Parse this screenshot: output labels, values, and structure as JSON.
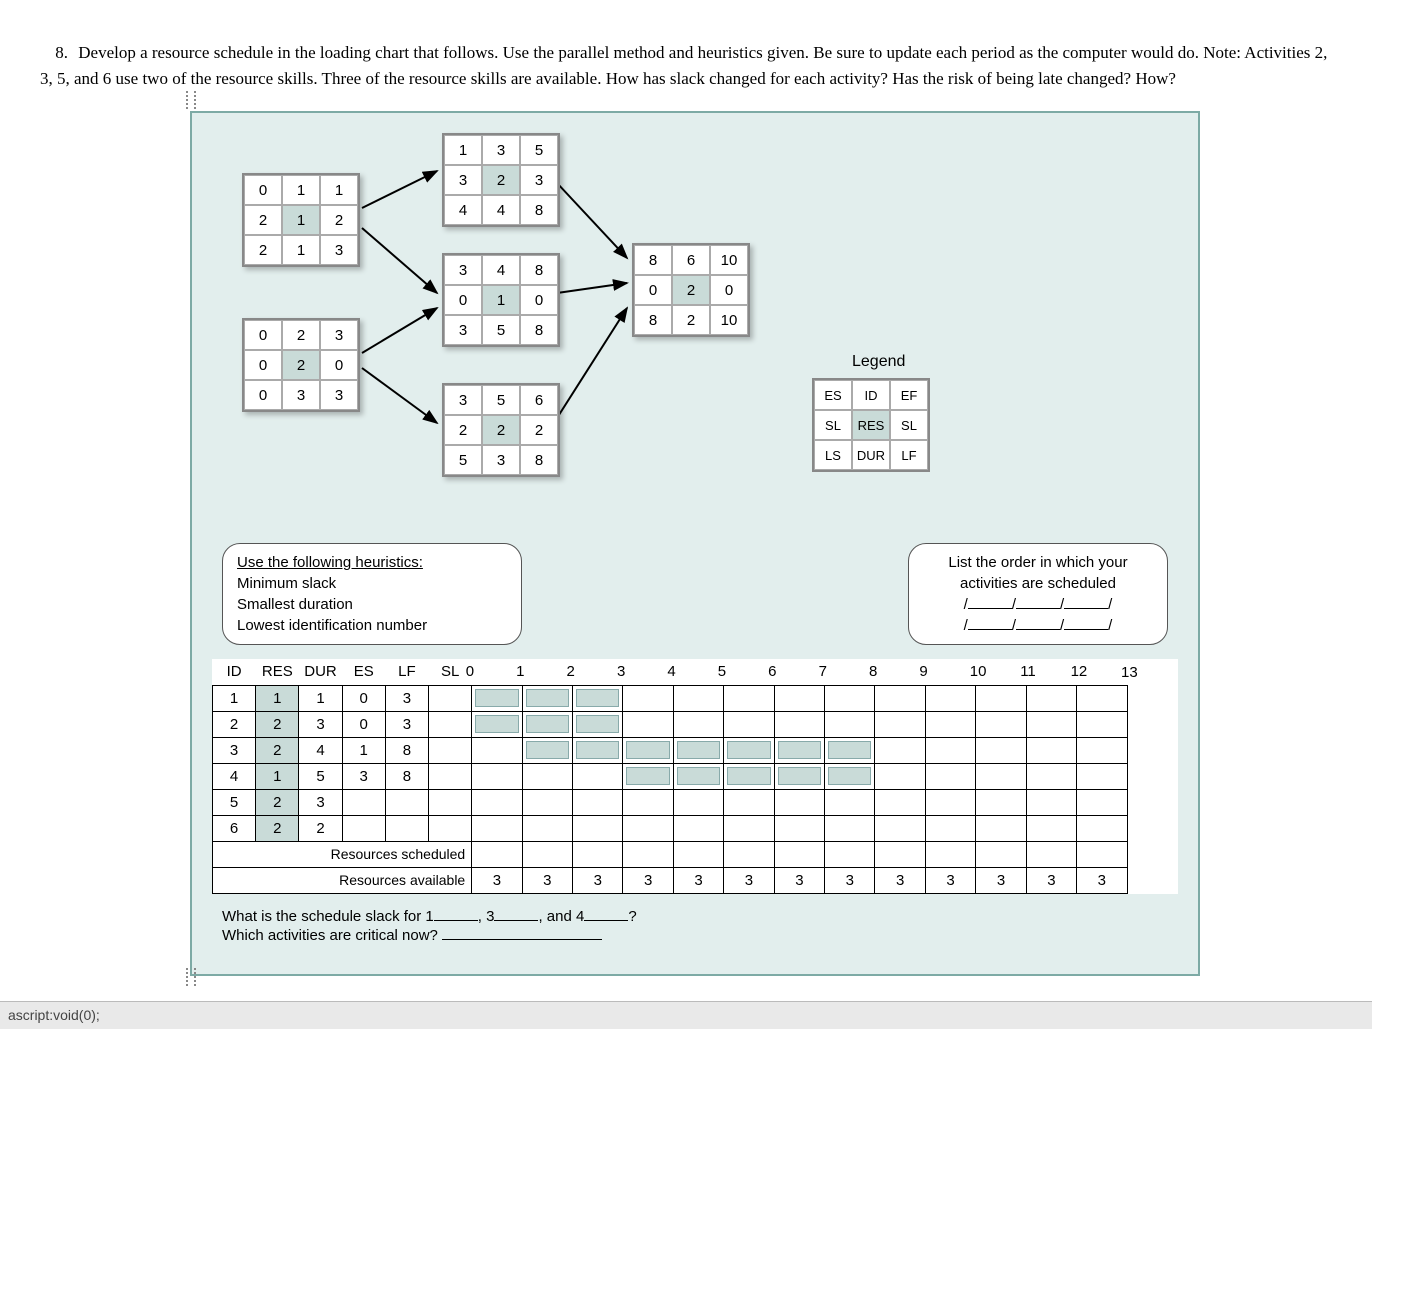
{
  "question": {
    "number": "8.",
    "text": "Develop a resource schedule in the loading chart that follows. Use the parallel method and heuristics given. Be sure to update each period as the computer would do. Note: Activities 2, 3, 5, and 6 use two of the resource skills. Three of the resource skills are available. How has slack changed for each activity? Has the risk of being late changed? How?"
  },
  "activities": {
    "a1": {
      "cells": [
        "0",
        "1",
        "1",
        "2",
        "1",
        "2",
        "2",
        "1",
        "3"
      ]
    },
    "a2": {
      "cells": [
        "0",
        "2",
        "3",
        "0",
        "2",
        "0",
        "0",
        "3",
        "3"
      ]
    },
    "a3": {
      "cells": [
        "1",
        "3",
        "5",
        "3",
        "2",
        "3",
        "4",
        "4",
        "8"
      ]
    },
    "a4": {
      "cells": [
        "3",
        "4",
        "8",
        "0",
        "1",
        "0",
        "3",
        "5",
        "8"
      ]
    },
    "a5": {
      "cells": [
        "3",
        "5",
        "6",
        "2",
        "2",
        "2",
        "5",
        "3",
        "8"
      ]
    },
    "a6": {
      "cells": [
        "8",
        "6",
        "10",
        "0",
        "2",
        "0",
        "8",
        "2",
        "10"
      ]
    }
  },
  "legend": {
    "label": "Legend",
    "cells": [
      "ES",
      "ID",
      "EF",
      "SL",
      "RES",
      "SL",
      "LS",
      "DUR",
      "LF"
    ]
  },
  "heuristics": {
    "title": "Use the following heuristics:",
    "items": [
      "Minimum slack",
      "Smallest duration",
      "Lowest identification number"
    ]
  },
  "orderbox": {
    "line1": "List the order in which your",
    "line2": "activities are scheduled"
  },
  "scheduleHeaders": [
    "ID",
    "RES",
    "DUR",
    "ES",
    "LF",
    "SL",
    "0",
    "1",
    "2",
    "3",
    "4",
    "5",
    "6",
    "7",
    "8",
    "9",
    "10",
    "11",
    "12",
    "13"
  ],
  "rows": [
    {
      "id": "1",
      "res": "1",
      "dur": "1",
      "es": "0",
      "lf": "3",
      "bar": [
        0,
        3
      ]
    },
    {
      "id": "2",
      "res": "2",
      "dur": "3",
      "es": "0",
      "lf": "3",
      "bar": [
        0,
        3
      ]
    },
    {
      "id": "3",
      "res": "2",
      "dur": "4",
      "es": "1",
      "lf": "8",
      "bar": [
        1,
        8
      ]
    },
    {
      "id": "4",
      "res": "1",
      "dur": "5",
      "es": "3",
      "lf": "8",
      "bar": [
        3,
        8
      ]
    },
    {
      "id": "5",
      "res": "2",
      "dur": "3",
      "es": "",
      "lf": "",
      "bar": null
    },
    {
      "id": "6",
      "res": "2",
      "dur": "2",
      "es": "",
      "lf": "",
      "bar": null
    }
  ],
  "resSchedLabel": "Resources scheduled",
  "resAvailLabel": "Resources available",
  "resAvailable": [
    "3",
    "3",
    "3",
    "3",
    "3",
    "3",
    "3",
    "3",
    "3",
    "3",
    "3",
    "3",
    "3"
  ],
  "footer": {
    "q1a": "What is the schedule slack for 1",
    "q1b": ", 3",
    "q1c": ", and 4",
    "q1d": "?",
    "q2": "Which activities are critical now?"
  },
  "status": "ascript:void(0);"
}
